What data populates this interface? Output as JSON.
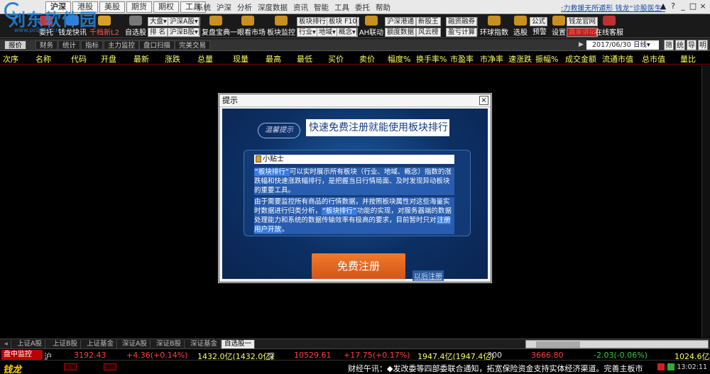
{
  "top": {
    "market_tabs": [
      "沪深",
      "港股",
      "美股",
      "期货",
      "期权",
      "工具"
    ],
    "active_market": "沪深",
    "menu": [
      "系统",
      "沪深",
      "分析",
      "深度数据",
      "资讯",
      "智能",
      "工具",
      "委托",
      "帮助"
    ],
    "ticker": ":力救援无所遁形 钱龙“诊股医生”",
    "window_controls": [
      "▲",
      "?",
      "_",
      "□",
      "×"
    ]
  },
  "watermark": {
    "text": "刘东软件园",
    "url": "www.pc0359.cn"
  },
  "toolbar": {
    "big": [
      {
        "id": "trade",
        "label": "委托",
        "color": "#cc3333"
      },
      {
        "id": "qianlong-quick",
        "label": "钱龙快讯",
        "color": "#3a7dd8"
      },
      {
        "id": "qianlong-l2",
        "label": "千档新L2",
        "color": "#d8a02a"
      },
      {
        "id": "self-select",
        "label": "自选股",
        "color": "#777"
      },
      {
        "id": "review",
        "label": "复盘宝典",
        "color": "#c89020"
      },
      {
        "id": "one-click",
        "label": "一眼看市场",
        "color": "#c89020"
      },
      {
        "id": "sector-monitor",
        "label": "板块监控",
        "color": "#c89020"
      },
      {
        "id": "ah-link",
        "label": "AH联动",
        "color": "#c89020"
      },
      {
        "id": "global-index",
        "label": "环球指数",
        "color": "#c89020"
      },
      {
        "id": "stock-pick",
        "label": "选股",
        "color": "#c89020"
      },
      {
        "id": "alert",
        "label": "预警",
        "color": "#c89020"
      },
      {
        "id": "settings",
        "label": "设置",
        "color": "#c89020"
      },
      {
        "id": "online-room",
        "label": "在线客服",
        "color": "#c03030"
      }
    ],
    "small": [
      {
        "id": "big-market",
        "label": "大盘▾"
      },
      {
        "id": "sh-a",
        "label": "沪深A股▾"
      },
      {
        "id": "rank",
        "label": "排 名"
      },
      {
        "id": "sh-b",
        "label": "沪深B股▾"
      },
      {
        "id": "sector-rank",
        "label": "板块排行"
      },
      {
        "id": "sector-f10",
        "label": "板块 F10"
      },
      {
        "id": "industry",
        "label": "行业▾"
      },
      {
        "id": "region",
        "label": "地域▾"
      },
      {
        "id": "concept",
        "label": "概念▾"
      },
      {
        "id": "hk-connect",
        "label": "沪深港通"
      },
      {
        "id": "margin",
        "label": "融资融券"
      },
      {
        "id": "new-stock",
        "label": "新股王"
      },
      {
        "id": "fund-flow",
        "label": "额度数据"
      },
      {
        "id": "wind-cloud",
        "label": "风云榜"
      },
      {
        "id": "surplus",
        "label": "盈亏计算"
      },
      {
        "id": "formula",
        "label": "公式"
      },
      {
        "id": "qianlong-web",
        "label": "钱龙官网"
      },
      {
        "id": "winner-lecture",
        "label": "赢家讲坛"
      }
    ]
  },
  "sub_tabs": [
    "报价",
    "财务",
    "统计",
    "指标",
    "主力监控",
    "盘口扫描",
    "完美交易"
  ],
  "active_sub_tab": "报价",
  "date": "2017/06/30",
  "period": "日线▾",
  "mini_buttons": [
    "筛",
    "统",
    "导",
    "明"
  ],
  "columns": [
    "次序",
    "名称",
    "代码",
    "开盘",
    "最新",
    "涨跌",
    "总量",
    "现量",
    "最高",
    "最低",
    "买价",
    "卖价",
    "幅度%",
    "换手率%",
    "市盈率",
    "市净率",
    "速涨跌",
    "振幅%",
    "成交金额",
    "流通市值",
    "总市值",
    "量比"
  ],
  "bottom_tabs": [
    "上证A股",
    "上证B股",
    "上证基金",
    "深证A股",
    "深证B股",
    "深证基金",
    "自选股一"
  ],
  "active_bottom_tab": "自选股一",
  "index_bar": {
    "badge": "盘中监控",
    "items": [
      {
        "name": "沪",
        "value": "3192.43",
        "change": "+4.36(+0.14%)",
        "volume": "1432.0亿(1432.0亿)"
      },
      {
        "name": "深",
        "value": "10529.61",
        "change": "+17.75(+0.17%)",
        "volume": "1947.4亿(1947.4亿)"
      },
      {
        "name": "300",
        "value": "3666.80",
        "change": "-2.03(-0.06%)",
        "volume": "1024.6亿"
      }
    ]
  },
  "status": {
    "logo": "钱龙",
    "news": "财经午讯：◆发改委等四部委联合通知，拓宽保险资金支持实体经济渠道。完善主板市",
    "time": "13:02:11"
  },
  "dialog": {
    "title": "提示",
    "close": "×",
    "badge": "温馨提示",
    "headline": "快速免费注册就能使用板块排行",
    "tip_title": "小贴士",
    "p1_hl": "“板块排行”",
    "p1_rest": "可以实时展示所有板块（行业、地域、概念）指数的涨跌幅和快速涨跌幅排行，是把握当日行情局面、及时发现异动板块的重要工具。",
    "p2_a": "由于需要监控所有商品的行情数据，并按照板块属性对这些海量实时数据进行归类分析，",
    "p2_hl": "“板块排行”",
    "p2_b": "功能的实现，对服务器端的数据处理能力和系统的数据传输效率有极高的要求，目前暂时只对",
    "p2_hl2": "注册用户开放",
    "p2_end": "。",
    "register_button": "免费注册",
    "later_link": "以后注册"
  }
}
